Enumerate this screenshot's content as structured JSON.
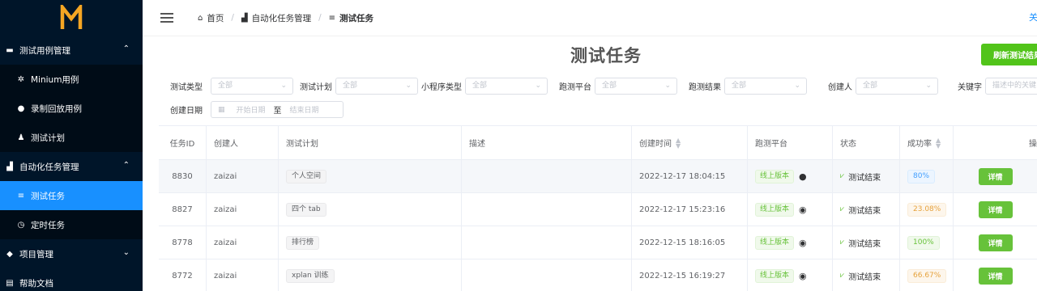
{
  "sidebar": {
    "logo_letter": "M",
    "items": [
      {
        "label": "测试用例管理",
        "icon": "folder-icon",
        "type": "group",
        "expanded": true
      },
      {
        "label": "Minium用例",
        "icon": "gear-icon",
        "type": "sub"
      },
      {
        "label": "录制回放用例",
        "icon": "help-circle-icon",
        "type": "sub"
      },
      {
        "label": "测试计划",
        "icon": "user-icon",
        "type": "sub"
      },
      {
        "label": "自动化任务管理",
        "icon": "bar-chart-icon",
        "type": "group",
        "expanded": true
      },
      {
        "label": "测试任务",
        "icon": "list-icon",
        "type": "sub",
        "active": true
      },
      {
        "label": "定时任务",
        "icon": "alarm-clock-icon",
        "type": "sub"
      },
      {
        "label": "项目管理",
        "icon": "layers-icon",
        "type": "group",
        "expanded": false
      },
      {
        "label": "帮助文档",
        "icon": "book-icon",
        "type": "group"
      }
    ]
  },
  "breadcrumb": {
    "home": "首页",
    "section": "自动化任务管理",
    "current": "测试任务"
  },
  "topbar": {
    "right_link": "关"
  },
  "page": {
    "title": "测试任务",
    "refresh_button": "刷新测试结果"
  },
  "filters": {
    "test_type": {
      "label": "测试类型",
      "value": "全部"
    },
    "test_plan": {
      "label": "测试计划",
      "value": "全部"
    },
    "miniprogram_type": {
      "label": "小程序类型",
      "value": "全部"
    },
    "platform": {
      "label": "跑测平台",
      "value": "全部"
    },
    "result": {
      "label": "跑测结果",
      "value": "全部"
    },
    "creator": {
      "label": "创建人",
      "value": "全部"
    },
    "keyword": {
      "label": "关键字",
      "placeholder": "描述中的关键"
    },
    "date": {
      "label": "创建日期",
      "start_placeholder": "开始日期",
      "separator": "至",
      "end_placeholder": "结束日期"
    }
  },
  "table": {
    "headers": {
      "id": "任务ID",
      "creator": "创建人",
      "plan": "测试计划",
      "desc": "描述",
      "time": "创建时间",
      "platform": "跑测平台",
      "status": "状态",
      "rate": "成功率",
      "op": "操"
    },
    "rows": [
      {
        "id": "8830",
        "creator": "zaizai",
        "plan": "个人空间",
        "desc": "",
        "time": "2022-12-17 18:04:15",
        "platform": "线上版本",
        "os_icon": "apple-icon",
        "status": "测试结束",
        "rate": "80%",
        "rate_color": "blue",
        "action": "详情"
      },
      {
        "id": "8827",
        "creator": "zaizai",
        "plan": "四个 tab",
        "desc": "",
        "time": "2022-12-17 15:23:16",
        "platform": "线上版本",
        "os_icon": "android-icon",
        "status": "测试结束",
        "rate": "23.08%",
        "rate_color": "orange",
        "action": "详情"
      },
      {
        "id": "8778",
        "creator": "zaizai",
        "plan": "排行榜",
        "desc": "",
        "time": "2022-12-15 18:16:05",
        "platform": "线上版本",
        "os_icon": "android-icon",
        "status": "测试结束",
        "rate": "100%",
        "rate_color": "green",
        "action": "详情"
      },
      {
        "id": "8772",
        "creator": "zaizai",
        "plan": "xplan 训练",
        "desc": "",
        "time": "2022-12-15 16:19:27",
        "platform": "线上版本",
        "os_icon": "android-icon",
        "status": "测试结束",
        "rate": "66.67%",
        "rate_color": "orange",
        "action": "详情"
      }
    ]
  },
  "colors": {
    "sidebar_bg": "#001529",
    "active_menu": "#1890ff",
    "success": "#67c23a",
    "logo": "#f5a623"
  }
}
